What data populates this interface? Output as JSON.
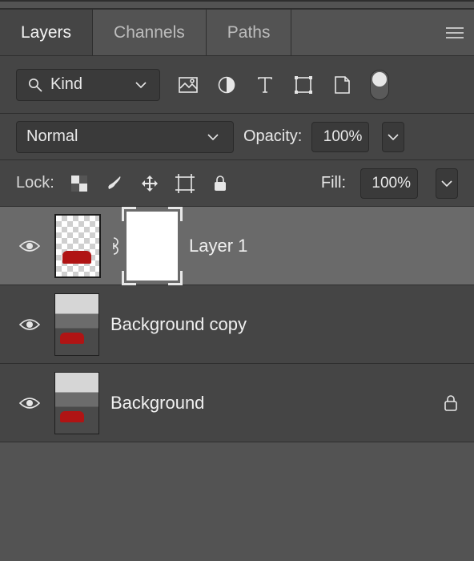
{
  "tabs": {
    "layers": "Layers",
    "channels": "Channels",
    "paths": "Paths"
  },
  "filter": {
    "kind": "Kind"
  },
  "blend": {
    "mode": "Normal",
    "opacity_label": "Opacity:",
    "opacity_value": "100%"
  },
  "lock": {
    "label": "Lock:",
    "fill_label": "Fill:",
    "fill_value": "100%"
  },
  "layers": [
    {
      "name": "Layer 1"
    },
    {
      "name": "Background copy"
    },
    {
      "name": "Background"
    }
  ]
}
